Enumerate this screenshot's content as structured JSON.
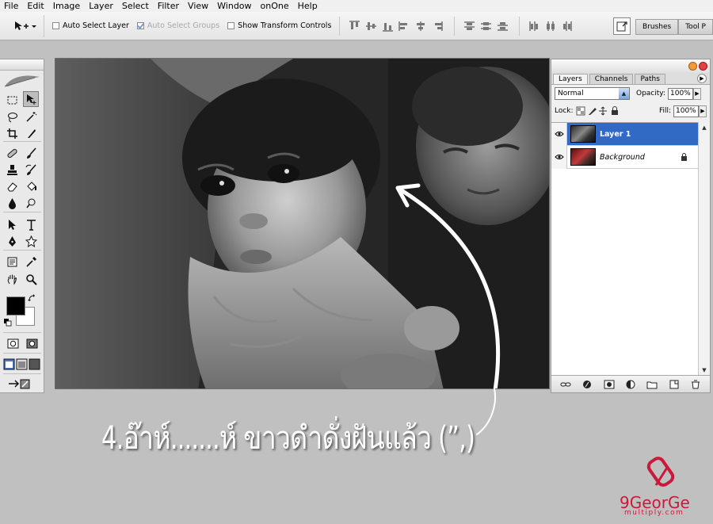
{
  "menu": [
    "File",
    "Edit",
    "Image",
    "Layer",
    "Select",
    "Filter",
    "View",
    "Window",
    "onOne",
    "Help"
  ],
  "options_bar": {
    "auto_select_layer": "Auto Select Layer",
    "auto_select_groups": "Auto Select Groups",
    "show_transform_controls": "Show Transform Controls"
  },
  "palette_well": {
    "brushes": "Brushes",
    "tool_presets": "Tool P"
  },
  "layers_panel": {
    "tabs": [
      "Layers",
      "Channels",
      "Paths"
    ],
    "blend_mode": "Normal",
    "opacity_label": "Opacity:",
    "opacity": "100%",
    "lock_label": "Lock:",
    "fill_label": "Fill:",
    "fill": "100%",
    "layers": [
      {
        "name": "Layer 1",
        "selected": true
      },
      {
        "name": "Background",
        "selected": false
      }
    ]
  },
  "caption": "4.อ๊าห์.......ห์   ขาวดำดั่งฝันแล้ว (”,)",
  "watermark": {
    "name": "9GeorGe",
    "sub": "multiply.com"
  },
  "colors": {
    "selection": "#316ac5",
    "watermark": "#c91a3c",
    "workspace": "#c0c0c0"
  }
}
